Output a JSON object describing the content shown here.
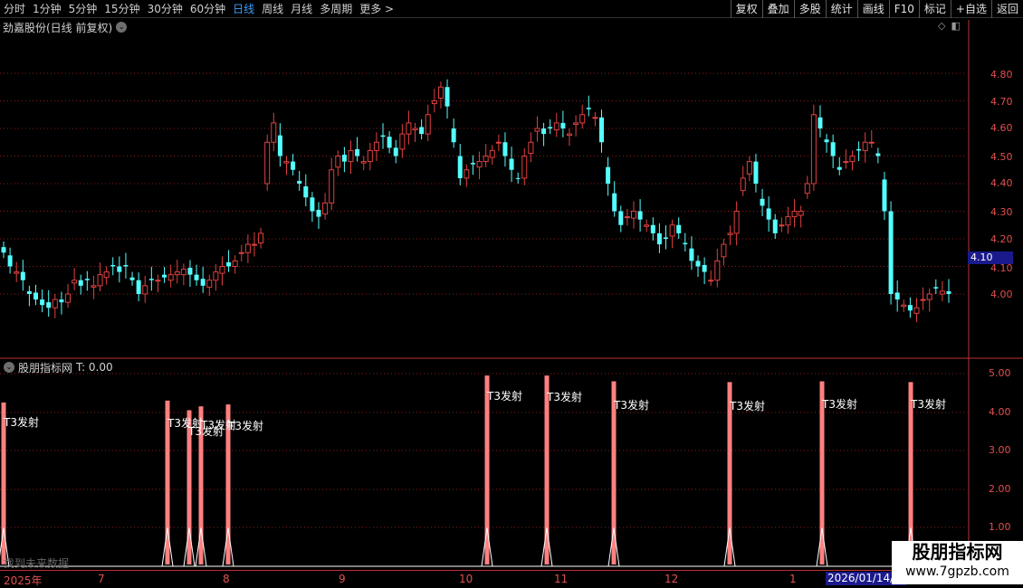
{
  "toolbar": {
    "periods": [
      "分时",
      "1分钟",
      "5分钟",
      "15分钟",
      "30分钟",
      "60分钟",
      "日线",
      "周线",
      "月线",
      "多周期",
      "更多 >"
    ],
    "active_period": "日线",
    "tools": [
      "复权",
      "叠加",
      "多股",
      "统计",
      "画线",
      "F10",
      "标记",
      "+自选",
      "返回"
    ]
  },
  "main_chart": {
    "stock_title": "劲嘉股份(日线 前复权)",
    "price_ticks": [
      "4.80",
      "4.70",
      "4.60",
      "4.50",
      "4.40",
      "4.30",
      "4.20",
      "4.10",
      "4.00"
    ],
    "current_price": "4.10",
    "colors": {
      "up": "#e04040",
      "down": "#54ffff",
      "grid": "#8a1c1c",
      "axis": "#c03030"
    }
  },
  "indicator": {
    "name": "股朋指标网",
    "t_value": "T: 0.00",
    "ticks": [
      "5.00",
      "4.00",
      "3.00",
      "2.00",
      "1.00"
    ],
    "signal_label": "T3发射",
    "note": "找到未来数据"
  },
  "x_axis": {
    "months": [
      "2025年",
      "7",
      "8",
      "9",
      "10",
      "11",
      "12",
      "1"
    ],
    "cursor_date": "2026/01/14/三"
  },
  "watermark": {
    "line1": "股朋指标网",
    "line2": "www.7gpzb.com"
  },
  "chart_data": {
    "type": "candlestick",
    "title": "劲嘉股份(日线 前复权)",
    "y_range": [
      3.85,
      4.92
    ],
    "y_ticks": [
      4.0,
      4.1,
      4.2,
      4.3,
      4.4,
      4.5,
      4.6,
      4.7,
      4.8
    ],
    "close_approx": [
      4.15,
      4.1,
      4.08,
      4.05,
      4.0,
      3.98,
      3.96,
      3.95,
      3.98,
      3.97,
      4.0,
      4.05,
      4.03,
      4.05,
      4.03,
      4.07,
      4.08,
      4.1,
      4.08,
      4.1,
      4.05,
      4.0,
      4.03,
      4.05,
      4.05,
      4.06,
      4.07,
      4.08,
      4.09,
      4.07,
      4.05,
      4.03,
      4.05,
      4.08,
      4.1,
      4.1,
      4.12,
      4.15,
      4.18,
      4.18,
      4.22,
      4.55,
      4.62,
      4.5,
      4.48,
      4.45,
      4.4,
      4.35,
      4.3,
      4.28,
      4.33,
      4.45,
      4.5,
      4.48,
      4.52,
      4.5,
      4.48,
      4.52,
      4.55,
      4.57,
      4.53,
      4.5,
      4.58,
      4.62,
      4.6,
      4.58,
      4.65,
      4.7,
      4.75,
      4.68,
      4.55,
      4.42,
      4.45,
      4.47,
      4.48,
      4.5,
      4.52,
      4.55,
      4.5,
      4.45,
      4.42,
      4.5,
      4.55,
      4.6,
      4.58,
      4.6,
      4.62,
      4.6,
      4.58,
      4.62,
      4.65,
      4.67,
      4.64,
      4.55,
      4.4,
      4.3,
      4.25,
      4.28,
      4.3,
      4.27,
      4.25,
      4.22,
      4.18,
      4.2,
      4.25,
      4.22,
      4.18,
      4.12,
      4.1,
      4.08,
      4.05,
      4.12,
      4.18,
      4.22,
      4.3,
      4.42,
      4.48,
      4.4,
      4.32,
      4.27,
      4.22,
      4.25,
      4.28,
      4.3,
      4.3,
      4.4,
      4.65,
      4.6,
      4.55,
      4.5,
      4.45,
      4.48,
      4.5,
      4.52,
      4.55,
      4.55,
      4.5,
      4.3,
      4.0,
      3.98,
      3.96,
      3.94,
      3.95,
      3.98,
      4.0,
      4.02,
      4.01,
      4.0
    ],
    "indicator_signals": {
      "label": "T3发射",
      "values": [
        4.25,
        4.3,
        4.05,
        4.15,
        4.2,
        4.95,
        4.95,
        4.8,
        4.78,
        4.8,
        4.78
      ]
    }
  }
}
